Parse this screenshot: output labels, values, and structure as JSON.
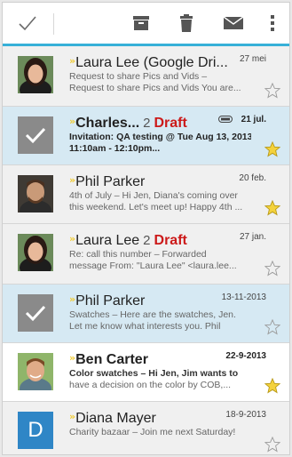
{
  "toolbar": {
    "done": "done-icon",
    "icons": [
      "archive-icon",
      "trash-icon",
      "mark-unread-icon",
      "overflow-icon"
    ]
  },
  "accent_color": "#37b0d8",
  "messages": [
    {
      "sender": "Laura Lee (Google Dri...",
      "count": "",
      "draft": "",
      "date": "27 mei",
      "line1": "Request to share Pics and Vids –",
      "line2": "Request to share Pics and Vids You are...",
      "starred": false,
      "selected": false
    },
    {
      "sender": "Charles...",
      "count": "2",
      "draft": "Draft",
      "date": "21 jul.",
      "line1": "Invitation: QA testing @ Tue Aug 13, 2013",
      "line2": "11:10am - 12:10pm...",
      "starred": true,
      "selected": true
    },
    {
      "sender": "Phil Parker",
      "count": "",
      "draft": "",
      "date": "20 feb.",
      "line1": "4th of July – Hi Jen, Diana's coming over",
      "line2": "this weekend. Let's meet up! Happy 4th ...",
      "starred": true,
      "selected": false
    },
    {
      "sender": "Laura Lee",
      "count": "2",
      "draft": "Draft",
      "date": "27 jan.",
      "line1": "Re: call this number – Forwarded",
      "line2": "message From: \"Laura Lee\" <laura.lee...",
      "starred": false,
      "selected": false
    },
    {
      "sender": "Phil Parker",
      "count": "",
      "draft": "",
      "date": "13-11-2013",
      "line1": "Swatches – Here are the swatches, Jen.",
      "line2": "Let me know what interests you. Phil",
      "starred": false,
      "selected": true
    },
    {
      "sender": "Ben Carter",
      "count": "",
      "draft": "",
      "date": "22-9-2013",
      "line1": "Color swatches – Hi Jen, Jim wants to",
      "line2": "have a decision on the color by COB,...",
      "starred": true,
      "selected": false
    },
    {
      "sender": "Diana Mayer",
      "count": "",
      "draft": "",
      "date": "18-9-2013",
      "line1": "Charity bazaar – Join me next Saturday!",
      "line2": "",
      "starred": false,
      "selected": false
    }
  ],
  "avatar_letter": "D"
}
